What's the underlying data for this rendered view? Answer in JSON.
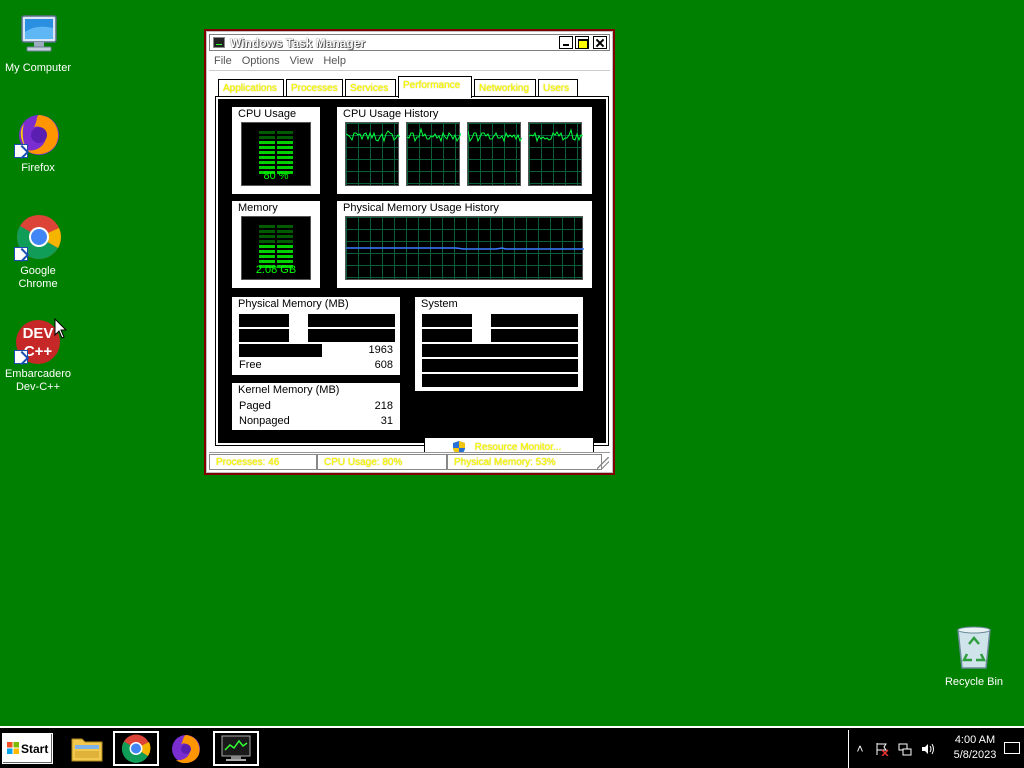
{
  "desktop": {
    "icons": [
      {
        "label": "My Computer"
      },
      {
        "label": "Firefox"
      },
      {
        "label": "Google Chrome"
      },
      {
        "label": "Embarcadero Dev-C++"
      },
      {
        "label": "Recycle Bin"
      }
    ]
  },
  "window": {
    "title": "Windows Task Manager",
    "menu": [
      "File",
      "Options",
      "View",
      "Help"
    ],
    "tabs": [
      "Applications",
      "Processes",
      "Services",
      "Performance",
      "Networking",
      "Users"
    ],
    "active_tab": "Performance",
    "cpu_usage": {
      "title": "CPU Usage",
      "value": "80 %",
      "percent": 80
    },
    "cpu_history": {
      "title": "CPU Usage History"
    },
    "memory": {
      "title": "Memory",
      "value": "2.08 GB",
      "percent": 53
    },
    "memory_history": {
      "title": "Physical Memory Usage History"
    },
    "physical_memory": {
      "title": "Physical Memory (MB)",
      "rows": [
        {
          "key": "",
          "value": ""
        },
        {
          "key": "",
          "value": ""
        },
        {
          "key": "",
          "value": "1963"
        },
        {
          "key": "Free",
          "value": "608"
        }
      ]
    },
    "kernel_memory": {
      "title": "Kernel Memory (MB)",
      "rows": [
        {
          "key": "Paged",
          "value": "218"
        },
        {
          "key": "Nonpaged",
          "value": "31"
        }
      ]
    },
    "system": {
      "title": "System"
    },
    "resource_monitor_label": "Resource Monitor...",
    "status": {
      "processes": "Processes: 46",
      "cpu": "CPU Usage: 80%",
      "memory": "Physical Memory: 53%"
    }
  },
  "taskbar": {
    "start_label": "Start",
    "clock_time": "4:00 AM",
    "clock_date": "5/8/2023",
    "tray_chevron": "˄"
  },
  "colors": {
    "desktop": "#008000",
    "meter_green": "#00d000",
    "graph_grid": "#0a5e3a",
    "disabled_text": "#ffff00",
    "window_border": "#800000"
  }
}
